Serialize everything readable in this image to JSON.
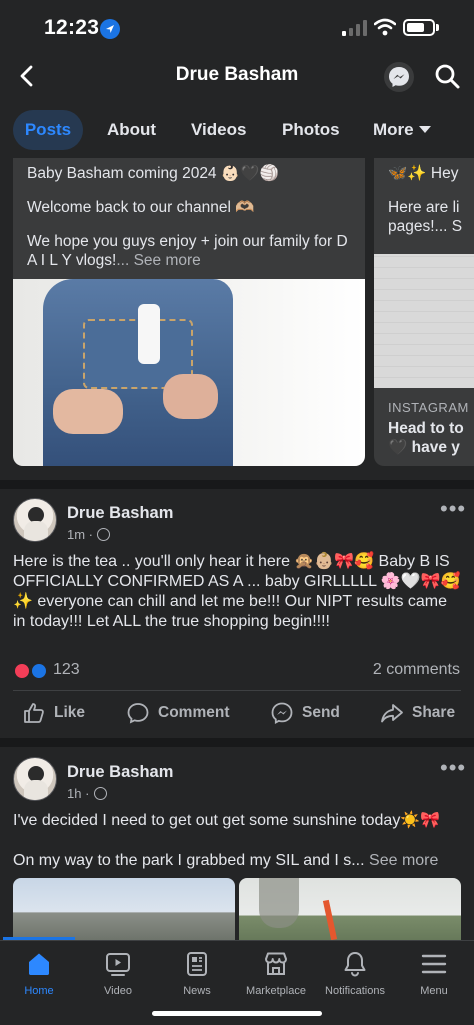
{
  "status_bar": {
    "time": "12:23"
  },
  "header": {
    "title": "Drue Basham"
  },
  "tabs": [
    {
      "label": "Posts"
    },
    {
      "label": "About"
    },
    {
      "label": "Videos"
    },
    {
      "label": "Photos"
    },
    {
      "label": "More"
    }
  ],
  "featured": {
    "card1": {
      "line1": "Baby Basham coming 2024 👶🏻🖤🏐",
      "line2": "Welcome back to our channel 🫶🏼",
      "line3": "We hope you guys enjoy + join our family for D A I L Y vlogs!",
      "see_more": "... See more"
    },
    "card2": {
      "line1": "🦋✨ Hey",
      "line2": "Here are li pages!... S",
      "source": "INSTAGRAM",
      "title1": "Head to to",
      "title2": "🖤 have y"
    }
  },
  "post1": {
    "author": "Drue Basham",
    "time": "1m · ",
    "text": "Here is the tea .. you'll only hear it here 🙊👶🏼🎀🥰 Baby B IS OFFICIALLY CONFIRMED AS A ... baby GIRLLLLL 🌸🤍🎀🥰✨ everyone can chill and let me be!!! Our NIPT results came in today!!! Let ALL the true shopping begin!!!!",
    "reactions": "123",
    "comments": "2 comments",
    "actions": {
      "like": "Like",
      "comment": "Comment",
      "send": "Send",
      "share": "Share"
    }
  },
  "post2": {
    "author": "Drue Basham",
    "time": "1h · ",
    "text_line1": "I've decided I need to get out get some sunshine today☀️🎀",
    "text_line2": "On my way to the park I grabbed my SIL and I s...",
    "see_more": " See more"
  },
  "bottom_nav": [
    {
      "label": "Home",
      "icon": "home-icon",
      "active": true
    },
    {
      "label": "Video",
      "icon": "video-icon"
    },
    {
      "label": "News",
      "icon": "news-icon"
    },
    {
      "label": "Marketplace",
      "icon": "marketplace-icon"
    },
    {
      "label": "Notifications",
      "icon": "bell-icon"
    },
    {
      "label": "Menu",
      "icon": "menu-icon"
    }
  ],
  "colors": {
    "accent": "#2d88ff",
    "background": "#242526",
    "surface": "#3a3b3c"
  }
}
